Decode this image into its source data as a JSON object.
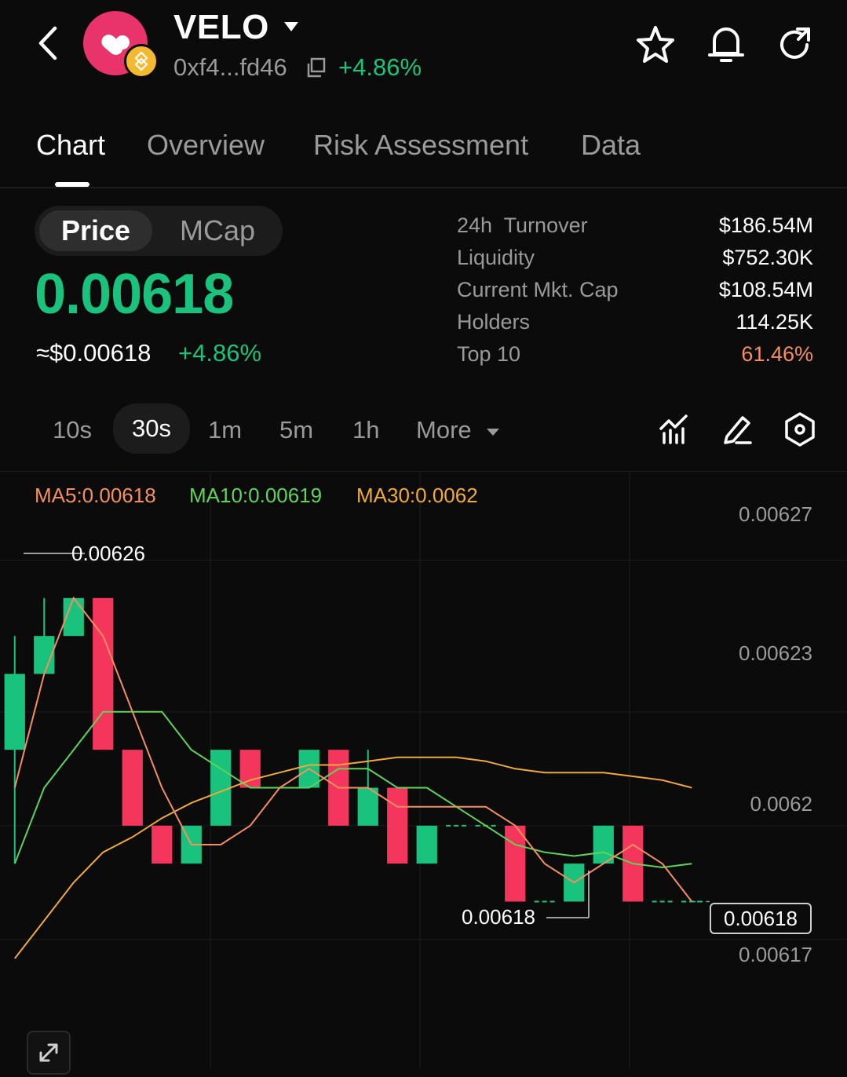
{
  "header": {
    "token_symbol": "VELO",
    "address": "0xf4...fd46",
    "change": "+4.86%"
  },
  "tabs": [
    {
      "label": "Chart",
      "active": true
    },
    {
      "label": "Overview",
      "active": false
    },
    {
      "label": "Risk Assessment",
      "active": false
    },
    {
      "label": "Data",
      "active": false
    }
  ],
  "toggle": {
    "price": "Price",
    "mcap": "MCap",
    "selected": "Price"
  },
  "price": {
    "value": "0.00618",
    "usd": "≈$0.00618",
    "change": "+4.86%"
  },
  "stats": [
    {
      "label": "24h  Turnover",
      "value": "$186.54M"
    },
    {
      "label": "Liquidity",
      "value": "$752.30K"
    },
    {
      "label": "Current Mkt. Cap",
      "value": "$108.54M"
    },
    {
      "label": "Holders",
      "value": "114.25K"
    },
    {
      "label": "Top 10",
      "value": "61.46%",
      "color": "#f58f5f"
    }
  ],
  "timeframes": [
    "10s",
    "30s",
    "1m",
    "5m",
    "1h"
  ],
  "timeframe_selected": "30s",
  "more_label": "More",
  "icons": {
    "back": "back-arrow-icon",
    "bnb": "bnb-chain-badge-icon",
    "star": "star-icon",
    "bell": "bell-icon",
    "refresh": "refresh-icon",
    "copy": "copy-icon",
    "indicator": "indicator-icon",
    "draw": "pencil-icon",
    "settings": "hexagon-settings-icon",
    "expand": "expand-icon"
  },
  "colors": {
    "up": "#19c37d",
    "down": "#f5365c",
    "ma5": "#f58f5f",
    "ma10": "#5fd35a",
    "ma30": "#f0a93b",
    "brand": "#e8336b"
  },
  "ma_labels": {
    "ma5": "MA5:0.00618",
    "ma10": "MA10:0.00619",
    "ma30": "MA30:0.0062"
  },
  "chart_data": {
    "type": "candlestick",
    "ylim": [
      0.006165,
      0.006285
    ],
    "y_ticks": [
      "0.00627",
      "0.00623",
      "0.0062",
      "0.00617"
    ],
    "y_tick_values": [
      0.00627,
      0.00623,
      0.0062,
      0.00617
    ],
    "high_label": "0.00626",
    "low_label": "0.00618",
    "last_price_label": "0.00618",
    "candles": [
      {
        "o": 0.00622,
        "h": 0.00625,
        "l": 0.00619,
        "c": 0.00624
      },
      {
        "o": 0.00624,
        "h": 0.00626,
        "l": 0.00624,
        "c": 0.00625
      },
      {
        "o": 0.00625,
        "h": 0.00626,
        "l": 0.00625,
        "c": 0.00626
      },
      {
        "o": 0.00626,
        "h": 0.00626,
        "l": 0.00622,
        "c": 0.00622
      },
      {
        "o": 0.00622,
        "h": 0.00622,
        "l": 0.0062,
        "c": 0.0062
      },
      {
        "o": 0.0062,
        "h": 0.0062,
        "l": 0.00619,
        "c": 0.00619
      },
      {
        "o": 0.00619,
        "h": 0.0062,
        "l": 0.00619,
        "c": 0.0062
      },
      {
        "o": 0.0062,
        "h": 0.00622,
        "l": 0.0062,
        "c": 0.00622
      },
      {
        "o": 0.00622,
        "h": 0.00622,
        "l": 0.00621,
        "c": 0.00621
      },
      {
        "o": 0.00621,
        "h": 0.00621,
        "l": 0.00621,
        "c": 0.00621
      },
      {
        "o": 0.00621,
        "h": 0.00622,
        "l": 0.00621,
        "c": 0.00622
      },
      {
        "o": 0.00622,
        "h": 0.00622,
        "l": 0.0062,
        "c": 0.0062
      },
      {
        "o": 0.0062,
        "h": 0.00622,
        "l": 0.0062,
        "c": 0.00621
      },
      {
        "o": 0.00621,
        "h": 0.00621,
        "l": 0.00619,
        "c": 0.00619
      },
      {
        "o": 0.00619,
        "h": 0.0062,
        "l": 0.00619,
        "c": 0.0062
      },
      {
        "o": 0.0062,
        "h": 0.0062,
        "l": 0.0062,
        "c": 0.0062
      },
      {
        "o": 0.0062,
        "h": 0.0062,
        "l": 0.0062,
        "c": 0.0062
      },
      {
        "o": 0.0062,
        "h": 0.0062,
        "l": 0.00618,
        "c": 0.00618
      },
      {
        "o": 0.00618,
        "h": 0.00618,
        "l": 0.00618,
        "c": 0.00618
      },
      {
        "o": 0.00618,
        "h": 0.00619,
        "l": 0.00618,
        "c": 0.00619
      },
      {
        "o": 0.00619,
        "h": 0.0062,
        "l": 0.00619,
        "c": 0.0062
      },
      {
        "o": 0.0062,
        "h": 0.0062,
        "l": 0.00618,
        "c": 0.00618
      },
      {
        "o": 0.00618,
        "h": 0.00618,
        "l": 0.00618,
        "c": 0.00618
      },
      {
        "o": 0.00618,
        "h": 0.00618,
        "l": 0.00618,
        "c": 0.00618
      }
    ],
    "ma5": [
      0.00621,
      0.00624,
      0.00626,
      0.00625,
      0.00623,
      0.00621,
      0.006195,
      0.006195,
      0.0062,
      0.00621,
      0.006215,
      0.00621,
      0.00621,
      0.006205,
      0.006205,
      0.006205,
      0.006205,
      0.0062,
      0.00619,
      0.006185,
      0.00619,
      0.006195,
      0.00619,
      0.00618
    ],
    "ma10": [
      0.00619,
      0.00621,
      0.00622,
      0.00623,
      0.00623,
      0.00623,
      0.00622,
      0.006215,
      0.00621,
      0.00621,
      0.00621,
      0.006215,
      0.006215,
      0.00621,
      0.00621,
      0.006205,
      0.0062,
      0.006195,
      0.006193,
      0.006192,
      0.006193,
      0.00619,
      0.006189,
      0.00619
    ],
    "ma30": [
      0.006165,
      0.006175,
      0.006185,
      0.006193,
      0.006197,
      0.006202,
      0.006206,
      0.006209,
      0.006212,
      0.006214,
      0.006216,
      0.006216,
      0.006217,
      0.006218,
      0.006218,
      0.006218,
      0.006217,
      0.006215,
      0.006214,
      0.006214,
      0.006214,
      0.006213,
      0.006212,
      0.00621
    ]
  }
}
